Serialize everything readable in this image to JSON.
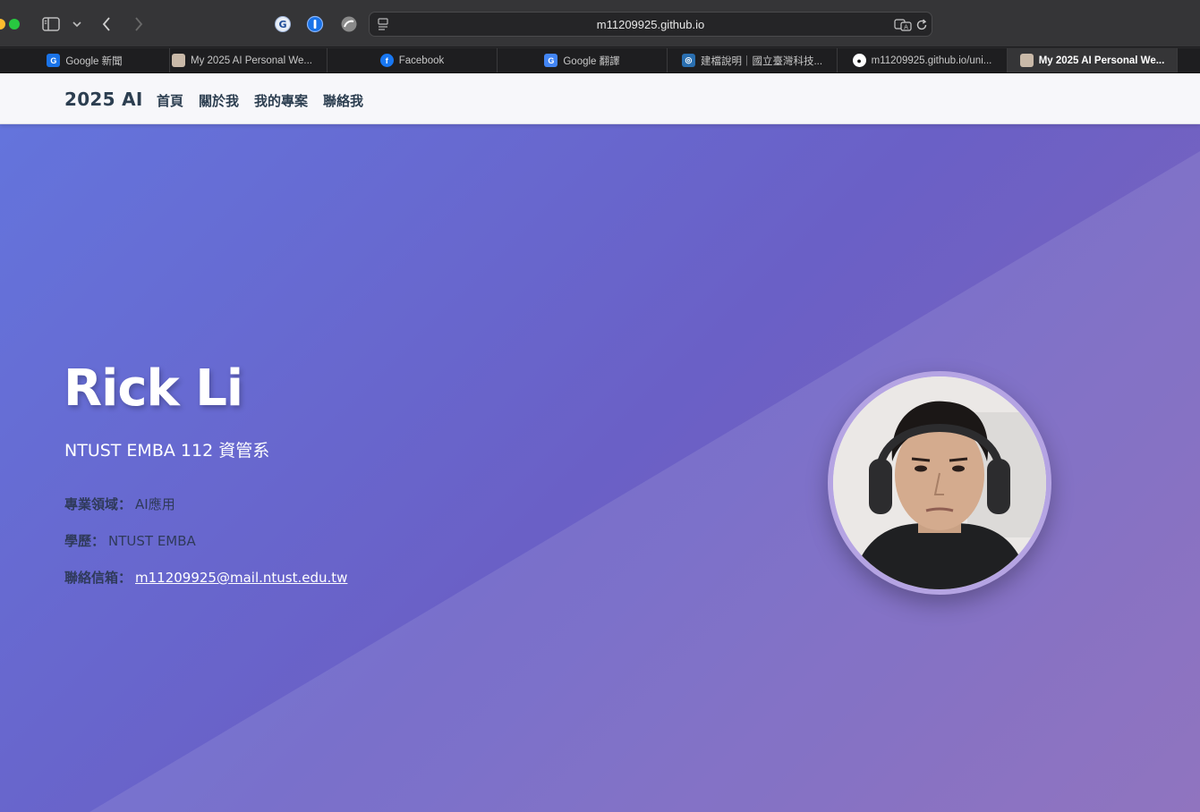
{
  "browser": {
    "url": "m11209925.github.io",
    "tabs": [
      {
        "label": "Google 新聞",
        "favicon": "google-news-icon",
        "active": false
      },
      {
        "label": "My 2025 AI Personal We...",
        "favicon": "site-avatar-icon",
        "active": false
      },
      {
        "label": "Facebook",
        "favicon": "facebook-icon",
        "active": false
      },
      {
        "label": "Google 翻譯",
        "favicon": "google-translate-icon",
        "active": false
      },
      {
        "label": "建檔說明｜國立臺灣科技...",
        "favicon": "ntust-icon",
        "active": false
      },
      {
        "label": "m11209925.github.io/uni...",
        "favicon": "github-icon",
        "active": false
      },
      {
        "label": "My 2025 AI Personal We...",
        "favicon": "site-avatar-icon",
        "active": true
      }
    ]
  },
  "navbar": {
    "brand": "2025 AI",
    "links": [
      "首頁",
      "關於我",
      "我的專案",
      "聯絡我"
    ]
  },
  "hero": {
    "name": "Rick Li",
    "subtitle": "NTUST EMBA 112 資管系",
    "field_label": "專業領域：",
    "field_value": "AI應用",
    "education_label": "學歷：",
    "education_value": "NTUST EMBA",
    "email_label": "聯絡信箱：",
    "email_value": "m11209925@mail.ntust.edu.tw"
  },
  "colors": {
    "nav_text": "#2c3e50",
    "hero_start": "#6474dc",
    "hero_end": "#8465b8",
    "avatar_border": "#b5a4e3"
  }
}
